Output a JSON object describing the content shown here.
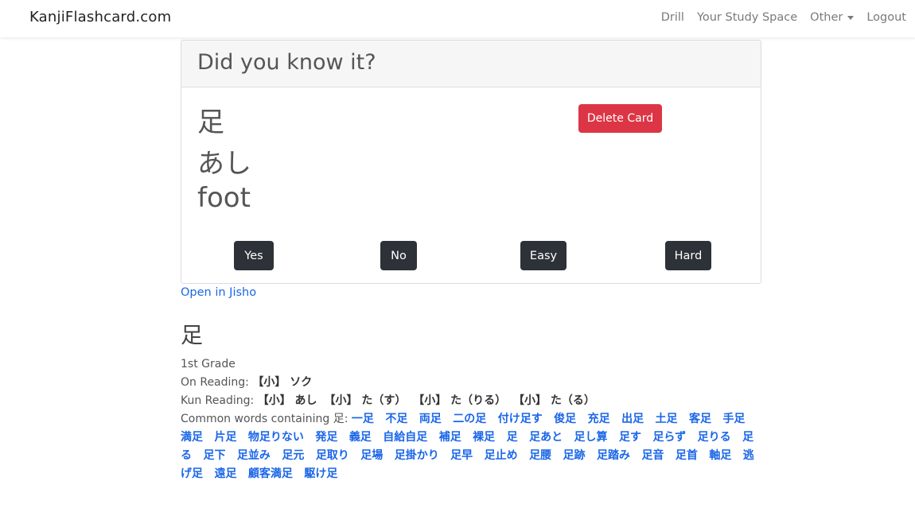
{
  "navbar": {
    "brand": "KanjiFlashcard.com",
    "links": [
      "Drill",
      "Your Study Space",
      "Other",
      "Logout"
    ]
  },
  "card": {
    "header": "Did you know it?",
    "front": "足",
    "reading": "あし",
    "meaning": "foot",
    "delete_label": "Delete Card",
    "buttons": {
      "yes": "Yes",
      "no": "No",
      "easy": "Easy",
      "hard": "Hard"
    }
  },
  "jisho_link": "Open in Jisho",
  "kanji_info": {
    "kanji": "足",
    "grade": "1st Grade",
    "on_label": "On Reading:",
    "on_readings": [
      "【小】 ソク"
    ],
    "kun_label": "Kun Reading:",
    "kun_readings": [
      "【小】 あし",
      "【小】 た（す）",
      "【小】 た（りる）",
      "【小】 た（る）"
    ],
    "common_label": "Common words containing 足:",
    "common_words": [
      "一足",
      "不足",
      "両足",
      "二の足",
      "付け足す",
      "俊足",
      "充足",
      "出足",
      "土足",
      "客足",
      "手足",
      "満足",
      "片足",
      "物足りない",
      "発足",
      "義足",
      "自給自足",
      "補足",
      "裸足",
      "足",
      "足あと",
      "足し算",
      "足す",
      "足らず",
      "足りる",
      "足る",
      "足下",
      "足並み",
      "足元",
      "足取り",
      "足場",
      "足掛かり",
      "足早",
      "足止め",
      "足腰",
      "足跡",
      "足踏み",
      "足音",
      "足首",
      "軸足",
      "逃げ足",
      "遠足",
      "顧客満足",
      "駆け足"
    ]
  }
}
